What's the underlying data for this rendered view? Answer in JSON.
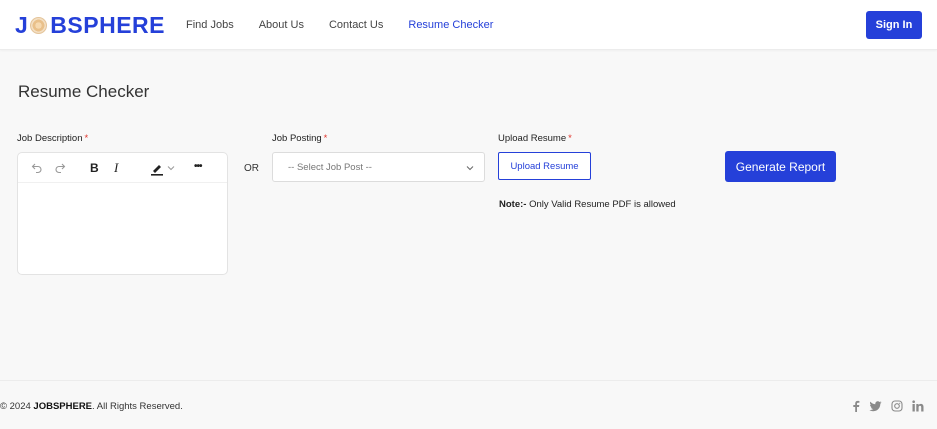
{
  "brand": {
    "pre": "J",
    "post": "BSPHERE"
  },
  "nav": {
    "items": [
      {
        "label": "Find Jobs"
      },
      {
        "label": "About Us"
      },
      {
        "label": "Contact Us"
      },
      {
        "label": "Resume Checker",
        "active": true
      }
    ],
    "sign_in": "Sign In"
  },
  "page": {
    "title": "Resume Checker"
  },
  "form": {
    "job_description_label": "Job Description",
    "required_mark": "*",
    "or_text": "OR",
    "job_posting_label": "Job Posting",
    "select_placeholder": "-- Select Job Post --",
    "upload_label": "Upload Resume",
    "upload_button": "Upload Resume",
    "note_bold": "Note:-",
    "note_text": " Only Valid Resume PDF is allowed",
    "generate_button": "Generate Report"
  },
  "editor": {
    "toolbar": [
      "undo-icon",
      "redo-icon",
      "bold-icon",
      "italic-icon",
      "highlighter-icon",
      "chevron-down-icon",
      "more-icon"
    ],
    "bold_glyph": "B",
    "italic_glyph": "I",
    "more_glyph": "•••"
  },
  "footer": {
    "copyright_pre": "© 2024 ",
    "brand": "JOBSPHERE",
    "copyright_post": ". All Rights Reserved.",
    "social": [
      "facebook-icon",
      "twitter-icon",
      "instagram-icon",
      "linkedin-icon"
    ]
  },
  "colors": {
    "accent": "#2540d9",
    "required": "#e0342b"
  }
}
